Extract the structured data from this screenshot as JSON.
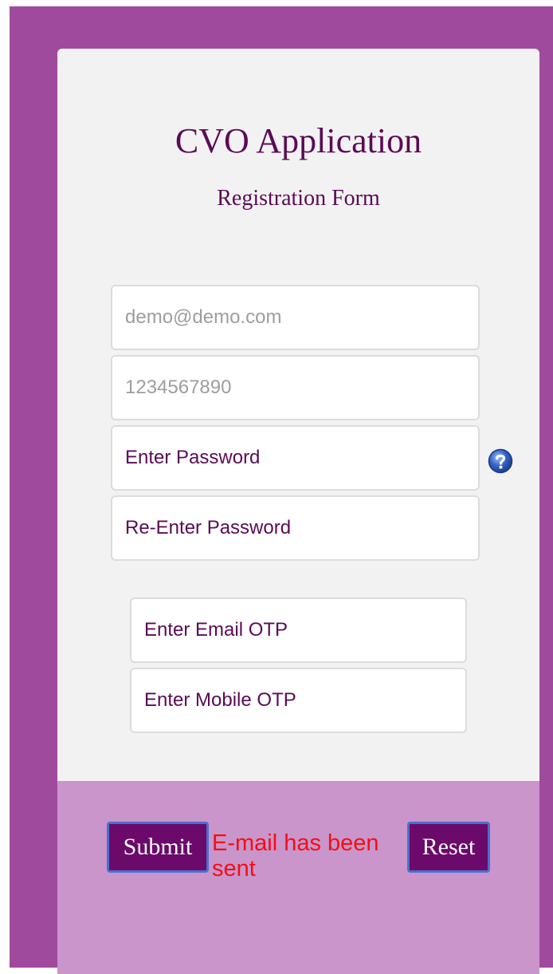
{
  "form": {
    "title": "CVO Application",
    "subtitle": "Registration Form",
    "email_value": "demo@demo.com",
    "mobile_value": "1234567890",
    "password_placeholder": "Enter Password",
    "reenter_password_placeholder": "Re-Enter Password",
    "email_otp_placeholder": "Enter Email OTP",
    "mobile_otp_placeholder": "Enter Mobile OTP",
    "help_icon": "question-mark-icon"
  },
  "footer": {
    "submit_label": "Submit",
    "reset_label": "Reset",
    "status_message": "E-mail has been sent"
  },
  "colors": {
    "frame_background": "#a04a9e",
    "card_background": "#f3f2f3",
    "footer_background": "#c995cb",
    "title_text": "#5b0b55",
    "button_background": "#6b0a6a",
    "button_border": "#4a6fcf",
    "status_message": "#f40e14",
    "prefilled_text": "#9d9d9d"
  }
}
